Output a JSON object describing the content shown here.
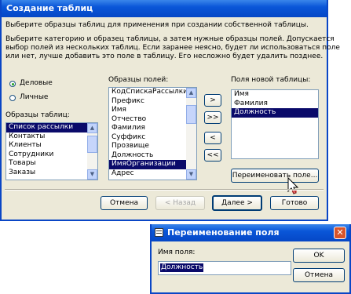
{
  "wizard": {
    "title": "Создание таблиц",
    "description": "Выберите образцы таблиц для применения при создании собственной таблицы.",
    "instructions": [
      "Выберите категорию и образец таблицы, а затем нужные образцы полей. Допускается",
      "выбор полей из нескольких таблиц. Если заранее неясно, будет ли использоваться поле",
      "или нет, лучше добавить это поле в таблицу. Его несложно будет удалить позднее."
    ],
    "category_options": [
      {
        "label": "Деловые",
        "selected": true
      },
      {
        "label": "Личные",
        "selected": false
      }
    ],
    "sample_tables_label": "Образцы таблиц:",
    "sample_tables": [
      "Список рассылки",
      "Контакты",
      "Клиенты",
      "Сотрудники",
      "Товары",
      "Заказы"
    ],
    "sample_tables_selected": "Список рассылки",
    "sample_fields_label": "Образцы полей:",
    "sample_fields": [
      "КодСпискаРассылки",
      "Префикс",
      "Имя",
      "Отчество",
      "Фамилия",
      "Суффикс",
      "Прозвище",
      "Должность",
      "ИмяОрганизации",
      "Адрес"
    ],
    "sample_fields_selected": "ИмяОрганизации",
    "move_buttons": [
      ">",
      ">>",
      "<",
      "<<"
    ],
    "new_table_fields_label": "Поля новой таблицы:",
    "new_table_fields": [
      "Имя",
      "Фамилия",
      "Должность"
    ],
    "new_table_fields_selected": "Должность",
    "rename_field_button": "Переименовать поле...",
    "cancel_button": "Отмена",
    "back_button": "< Назад",
    "next_button": "Далее >",
    "finish_button": "Готово"
  },
  "rename_dialog": {
    "title": "Переименование поля",
    "field_name_label": "Имя поля:",
    "field_name_value": "Должность",
    "ok_button": "OK",
    "cancel_button": "Отмена"
  },
  "colors": {
    "title_bar": "#0a56d8",
    "selection": "#0a0a6a",
    "dialog_face": "#ece9d8"
  }
}
